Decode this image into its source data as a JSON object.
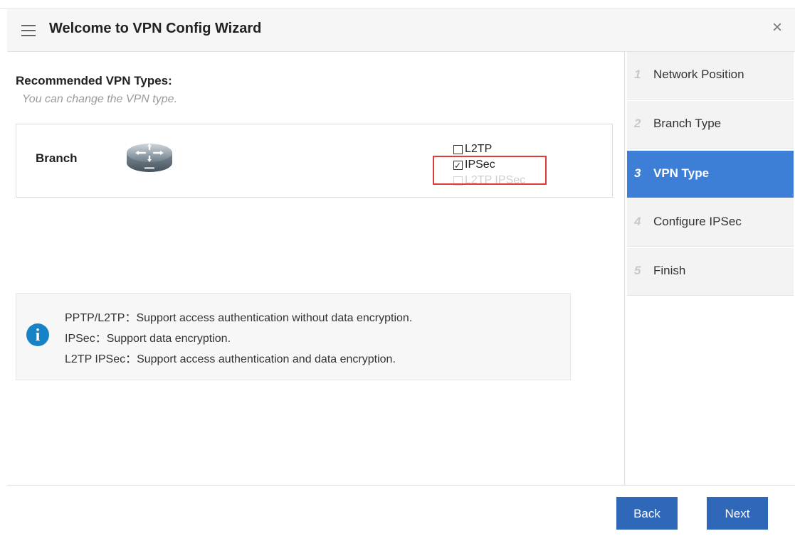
{
  "header": {
    "title": "Welcome to VPN Config Wizard",
    "close_glyph": "×"
  },
  "main": {
    "section_title": "Recommended VPN Types:",
    "section_subtitle": "You can change the VPN type.",
    "branch": {
      "label": "Branch",
      "icon": "router-icon",
      "options": [
        {
          "label": "L2TP",
          "checked": false,
          "disabled": false
        },
        {
          "label": "IPSec",
          "checked": true,
          "disabled": false
        },
        {
          "label": "L2TP IPSec",
          "checked": false,
          "disabled": true
        }
      ]
    },
    "info": {
      "icon": "info-icon",
      "lines": [
        "PPTP/L2TP：Support access authentication without data encryption.",
        "IPSec：Support data encryption.",
        "L2TP IPSec：Support access authentication and data encryption."
      ]
    }
  },
  "steps": [
    {
      "num": "1",
      "label": "Network Position"
    },
    {
      "num": "2",
      "label": "Branch Type"
    },
    {
      "num": "3",
      "label": "VPN Type",
      "active": true
    },
    {
      "num": "4",
      "label": "Configure IPSec"
    },
    {
      "num": "5",
      "label": "Finish"
    }
  ],
  "footer": {
    "back_label": "Back",
    "next_label": "Next"
  },
  "colors": {
    "accent": "#3d7fd6",
    "button": "#2f68b8",
    "highlight": "#e03a3a",
    "info": "#1583c5"
  }
}
